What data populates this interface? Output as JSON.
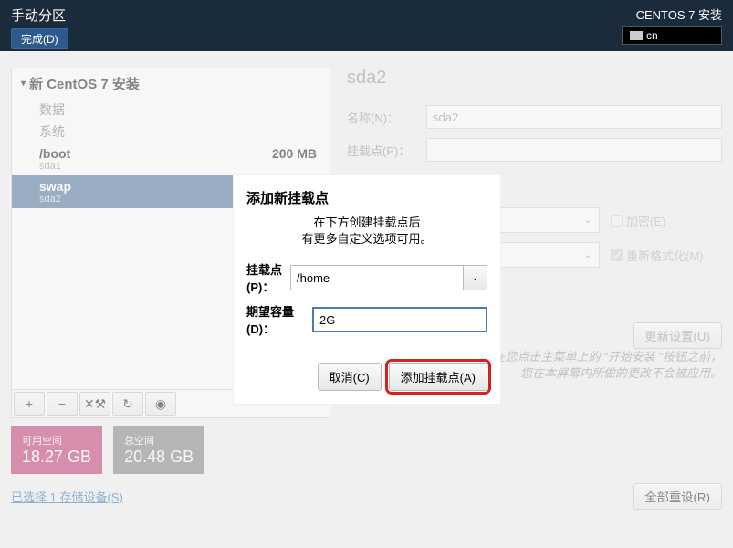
{
  "header": {
    "title": "手动分区",
    "done": "完成(D)",
    "subtitle": "CENTOS 7 安装",
    "lang": "cn"
  },
  "tree": {
    "root": "新 CentOS 7 安装",
    "cat_data": "数据",
    "cat_system": "系统",
    "partitions": [
      {
        "name": "/boot",
        "dev": "sda1",
        "size": "200 MB",
        "selected": false
      },
      {
        "name": "swap",
        "dev": "sda2",
        "size": "",
        "selected": true
      }
    ]
  },
  "detail": {
    "heading": "sda2",
    "name_label": "名称(N)：",
    "name_value": "sda2",
    "mount_label": "挂载点(P)：",
    "mount_value": "",
    "encrypt": "加密(E)",
    "reformat": "重新格式化(M)",
    "update": "更新设置(U)",
    "note1": "注意：在您点击主菜单上的 \"开始安装 \"按钮之前，",
    "note2": "您在本屏幕内所做的更改不会被应用。"
  },
  "space": {
    "free_label": "可用空间",
    "free_value": "18.27 GB",
    "total_label": "总空间",
    "total_value": "20.48 GB"
  },
  "footer": {
    "link": "已选择 1 存储设备(S)",
    "reset": "全部重设(R)"
  },
  "modal": {
    "title": "添加新挂载点",
    "desc1": "在下方创建挂载点后",
    "desc2": "有更多自定义选项可用。",
    "mount_label": "挂载点(P)：",
    "mount_value": "/home",
    "size_label": "期望容量(D)：",
    "size_value": "2G",
    "cancel": "取消(C)",
    "add": "添加挂载点(A)"
  }
}
